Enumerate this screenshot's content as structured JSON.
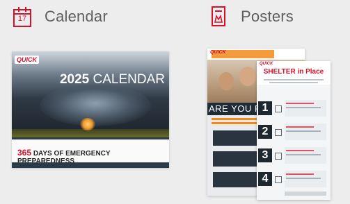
{
  "calendar_section": {
    "label": "Calendar",
    "icon": "calendar-icon",
    "icon_day": "17",
    "thumbnail": {
      "logo_text": "QUICK",
      "year": "2025",
      "title_word": "CALENDAR",
      "footer_number": "365",
      "footer_text": "DAYS OF EMERGENCY PREPAREDNESS"
    }
  },
  "posters_section": {
    "label": "Posters",
    "icon": "poster-icon",
    "poster_back": {
      "logo_text": "QUICK",
      "banner_text": "ARE YOU RE"
    },
    "poster_front": {
      "logo_text": "QUICK",
      "title": "SHELTER in Place",
      "steps": [
        "1",
        "2",
        "3",
        "4"
      ]
    }
  },
  "colors": {
    "accent_red": "#d8102a",
    "navy": "#1f2b37",
    "background": "#ededed"
  }
}
